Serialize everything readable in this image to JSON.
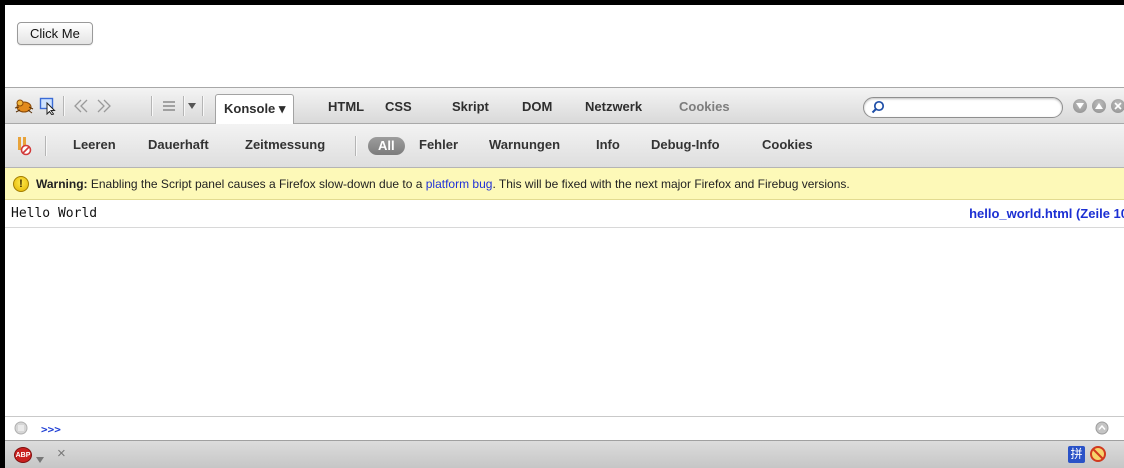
{
  "page": {
    "button_label": "Click Me"
  },
  "firebug": {
    "tabs": [
      {
        "label": "Konsole ▾",
        "active": true
      },
      {
        "label": "HTML"
      },
      {
        "label": "CSS"
      },
      {
        "label": "Skript"
      },
      {
        "label": "DOM"
      },
      {
        "label": "Netzwerk"
      },
      {
        "label": "Cookies",
        "disabled": true
      }
    ],
    "search": {
      "value": "",
      "placeholder": ""
    },
    "console_toolbar": {
      "clear": "Leeren",
      "persist": "Dauerhaft",
      "profile": "Zeitmessung",
      "filter_all": "All",
      "filter_errors": "Fehler",
      "filter_warnings": "Warnungen",
      "filter_info": "Info",
      "filter_debug": "Debug-Info",
      "filter_cookies": "Cookies"
    },
    "warning": {
      "label": "Warning:",
      "text_before": " Enabling the Script panel causes a Firefox slow-down due to a ",
      "link": "platform bug",
      "text_after": ". This will be fixed with the next major Firefox and Firebug versions."
    },
    "log": [
      {
        "message": "Hello World",
        "source": "hello_world.html (Zeile 10"
      }
    ],
    "command_line": {
      "prompt": ">>>",
      "value": ""
    }
  },
  "status_bar": {
    "abp_label": "ABP",
    "close": "×",
    "ime_label": "拼"
  },
  "colors": {
    "accent_link": "#1f31d8",
    "warning_bg": "#fdf9b8"
  }
}
